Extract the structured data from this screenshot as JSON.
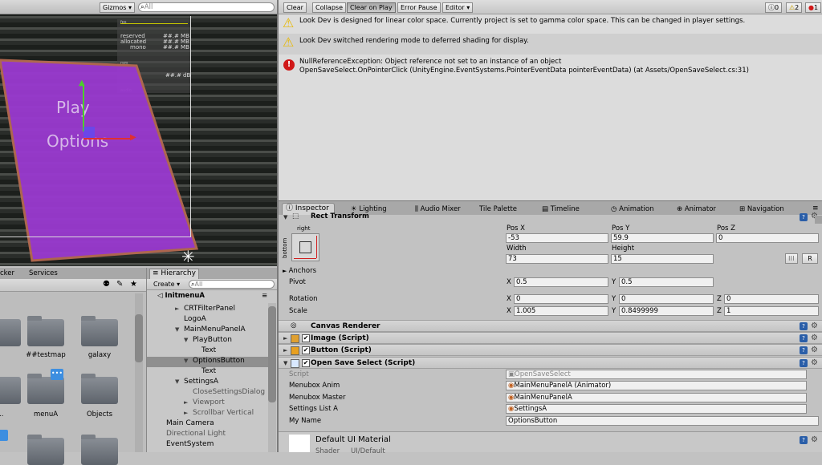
{
  "scene": {
    "gizmos": "Gizmos",
    "search": "All",
    "stats": {
      "reserved": "reserved",
      "allocated": "allocated",
      "mono": "mono",
      "mb1": "##.# MB",
      "mb2": "##.# MB",
      "mb3": "##.# MB",
      "db": "##.# dB",
      "tiny1": "fps",
      "tiny2": "rsm",
      "tiny3": "audio"
    },
    "play": "Play",
    "options": "Options"
  },
  "console": {
    "toolbar": [
      "Clear",
      "Collapse",
      "Clear on Play",
      "Error Pause",
      "Editor"
    ],
    "counts": {
      "info": "0",
      "warn": "2",
      "error": "1"
    },
    "messages": [
      {
        "type": "warn",
        "line1": "Look Dev is designed for linear color space. Currently project is set to gamma color space. This can be changed in player settings.",
        "line2": ""
      },
      {
        "type": "warn",
        "line1": "Look Dev switched rendering mode to deferred shading for display.",
        "line2": ""
      },
      {
        "type": "error",
        "line1": "NullReferenceException: Object reference not set to an instance of an object",
        "line2": "OpenSaveSelect.OnPointerClick (UnityEngine.EventSystems.PointerEventData pointerEventData) (at Assets/OpenSaveSelect.cs:31)"
      }
    ]
  },
  "tabs": [
    "Inspector",
    "Lighting",
    "Audio Mixer",
    "Tile Palette",
    "Timeline",
    "Animation",
    "Animator",
    "Navigation"
  ],
  "rect": {
    "title": "Rect Transform",
    "anchor_h": "right",
    "anchor_v": "bottom",
    "posx_l": "Pos X",
    "posy_l": "Pos Y",
    "posz_l": "Pos Z",
    "posx": "-53",
    "posy": "59.9",
    "posz": "0",
    "width_l": "Width",
    "height_l": "Height",
    "width": "73",
    "height": "15",
    "r": "R",
    "anchors": "Anchors",
    "pivot": "Pivot",
    "pivx": "0.5",
    "pivy": "0.5",
    "rotation": "Rotation",
    "rotx": "0",
    "roty": "0",
    "rotz": "0",
    "scale": "Scale",
    "sx": "1.005",
    "sy": "0.8499999",
    "sz": "1",
    "x": "X",
    "y": "Y",
    "z": "Z"
  },
  "components": {
    "canvas": "Canvas Renderer",
    "image": "Image (Script)",
    "button": "Button (Script)",
    "oss": "Open Save Select (Script)"
  },
  "oss": {
    "script_l": "Script",
    "script": "OpenSaveSelect",
    "anim_l": "Menubox Anim",
    "anim": "MainMenuPanelA (Animator)",
    "master_l": "Menubox Master",
    "master": "MainMenuPanelA",
    "settings_l": "Settings List A",
    "settings": "SettingsA",
    "name_l": "My Name",
    "name": "OptionsButton"
  },
  "material": {
    "title": "Default UI Material",
    "shader_l": "Shader",
    "shader": "UI/Default"
  },
  "project": {
    "tabs": [
      "cker",
      "Services"
    ],
    "items": [
      "##testmap",
      "galaxy",
      "ra...",
      "menuA",
      "Objects"
    ]
  },
  "hierarchy": {
    "tab": "Hierarchy",
    "create": "Create",
    "search": "All",
    "scene": "InitmenuA",
    "items": [
      {
        "t": "CRTFilterPanel",
        "ind": 1,
        "arrow": "►"
      },
      {
        "t": "LogoA",
        "ind": 1,
        "arrow": ""
      },
      {
        "t": "MainMenuPanelA",
        "ind": 1,
        "arrow": "▼"
      },
      {
        "t": "PlayButton",
        "ind": 2,
        "arrow": "▼"
      },
      {
        "t": "Text",
        "ind": 3,
        "arrow": ""
      },
      {
        "t": "OptionsButton",
        "ind": 2,
        "arrow": "▼",
        "sel": true
      },
      {
        "t": "Text",
        "ind": 3,
        "arrow": ""
      },
      {
        "t": "SettingsA",
        "ind": 1,
        "arrow": "▼"
      },
      {
        "t": "CloseSettingsDialog",
        "ind": 2,
        "arrow": "",
        "grey": true
      },
      {
        "t": "Viewport",
        "ind": 2,
        "arrow": "►",
        "grey": true
      },
      {
        "t": "Scrollbar Vertical",
        "ind": 2,
        "arrow": "►",
        "grey": true
      },
      {
        "t": "Main Camera",
        "ind": 0,
        "arrow": ""
      },
      {
        "t": "Directional Light",
        "ind": 0,
        "arrow": "",
        "grey": true
      },
      {
        "t": "EventSystem",
        "ind": 0,
        "arrow": ""
      }
    ]
  },
  "colors": {
    "accent": "#3d6eb8",
    "error": "#d01818",
    "warn": "#f0c020",
    "purple": "#9a3ad0"
  }
}
